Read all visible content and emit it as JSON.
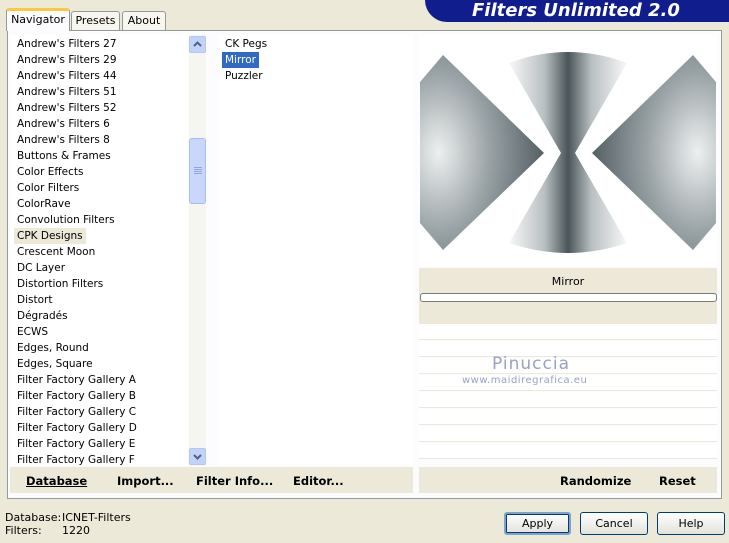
{
  "header": {
    "title": "Filters Unlimited 2.0"
  },
  "tabs": [
    {
      "label": "Navigator"
    },
    {
      "label": "Presets"
    },
    {
      "label": "About"
    }
  ],
  "categories": {
    "items": [
      "Andrew's Filters 27",
      "Andrew's Filters 29",
      "Andrew's Filters 44",
      "Andrew's Filters 51",
      "Andrew's Filters 52",
      "Andrew's Filters 6",
      "Andrew's Filters 8",
      "Buttons & Frames",
      "Color Effects",
      "Color Filters",
      "ColorRave",
      "Convolution Filters",
      "CPK Designs",
      "Crescent Moon",
      "DC Layer",
      "Distortion Filters",
      "Distort",
      "Dégradés",
      "ECWS",
      "Edges, Round",
      "Edges, Square",
      "Filter Factory Gallery A",
      "Filter Factory Gallery B",
      "Filter Factory Gallery C",
      "Filter Factory Gallery D",
      "Filter Factory Gallery E",
      "Filter Factory Gallery F"
    ],
    "selected": "CPK Designs"
  },
  "filters": {
    "items": [
      "CK Pegs",
      "Mirror",
      "Puzzler"
    ],
    "selected": "Mirror"
  },
  "preview": {
    "filter_name": "Mirror",
    "watermark_name": "Pinuccia",
    "watermark_url": "www.maidiregrafica.eu"
  },
  "bottom_left": {
    "database_label": "Database",
    "import_label": "Import...",
    "filter_info_label": "Filter Info...",
    "editor_label": "Editor..."
  },
  "bottom_right": {
    "randomize_label": "Randomize",
    "reset_label": "Reset"
  },
  "status": {
    "database_key": "Database:",
    "database_value": "ICNET-Filters",
    "filters_key": "Filters:",
    "filters_value": "1220"
  },
  "buttons": {
    "apply": "Apply",
    "cancel": "Cancel",
    "help": "Help"
  },
  "colors": {
    "header_bg": "#0f1e8c",
    "selection_blue": "#316ac5",
    "window_bg": "#ece9d8",
    "tab_highlight": "#ffc83c"
  }
}
